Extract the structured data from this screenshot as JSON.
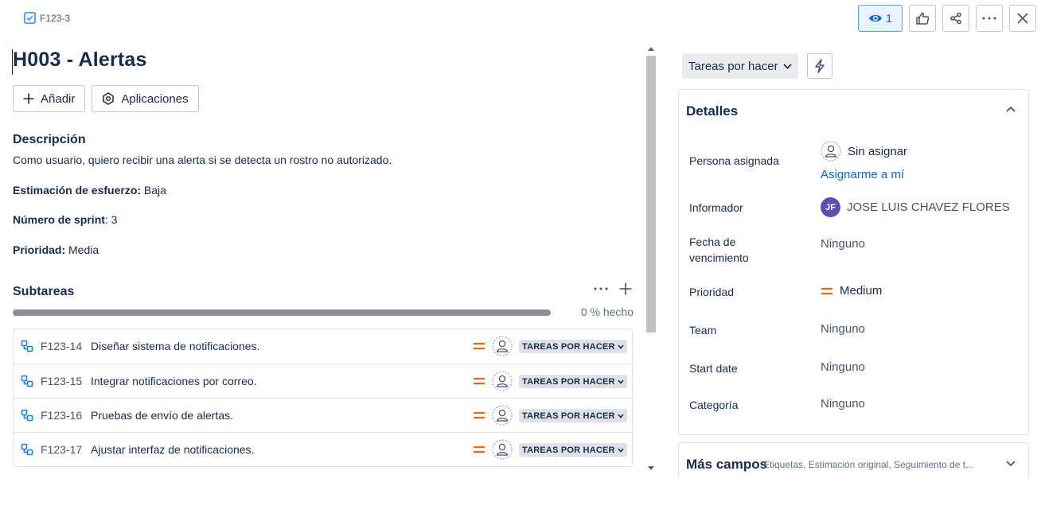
{
  "breadcrumb": {
    "key": "F123-3"
  },
  "top_actions": {
    "watch_count": "1"
  },
  "issue": {
    "title": "H003 - Alertas",
    "buttons": {
      "add": "Añadir",
      "apps": "Aplicaciones"
    },
    "description_heading": "Descripción",
    "description_text": "Como usuario, quiero recibir una alerta si se detecta un rostro no autorizado.",
    "fields": [
      {
        "label": "Estimación de esfuerzo:",
        "value": " Baja"
      },
      {
        "label": "Número de sprint",
        "value": ": 3"
      },
      {
        "label": "Prioridad:",
        "value": " Media"
      }
    ]
  },
  "subtasks": {
    "heading": "Subtareas",
    "progress_text": "0 % hecho",
    "progress_fraction": 0,
    "status_label": "TAREAS POR HACER",
    "items": [
      {
        "key": "F123-14",
        "summary": "Diseñar sistema de notificaciones."
      },
      {
        "key": "F123-15",
        "summary": "Integrar notificaciones por correo."
      },
      {
        "key": "F123-16",
        "summary": "Pruebas de envío de alertas."
      },
      {
        "key": "F123-17",
        "summary": "Ajustar interfaz de notificaciones."
      }
    ]
  },
  "sidebar": {
    "status_button": "Tareas por hacer",
    "details_heading": "Detalles",
    "assignee_label": "Persona asignada",
    "assignee_value": "Sin asignar",
    "assign_me": "Asignarme a mí",
    "reporter_label": "Informador",
    "reporter_initials": "JF",
    "reporter_value": "JOSE LUIS CHAVEZ FLORES",
    "due_label": "Fecha de vencimiento",
    "due_value": "Ninguno",
    "priority_label": "Prioridad",
    "priority_value": "Medium",
    "team_label": "Team",
    "team_value": "Ninguno",
    "start_label": "Start date",
    "start_value": "Ninguno",
    "category_label": "Categoría",
    "category_value": "Ninguno",
    "more_heading": "Más campos",
    "more_summary": "Etiquetas, Estimación original, Seguimiento de t..."
  },
  "colors": {
    "accent": "#0c66e4",
    "priority_medium": "#e56910",
    "avatar": "#5e4db2"
  }
}
